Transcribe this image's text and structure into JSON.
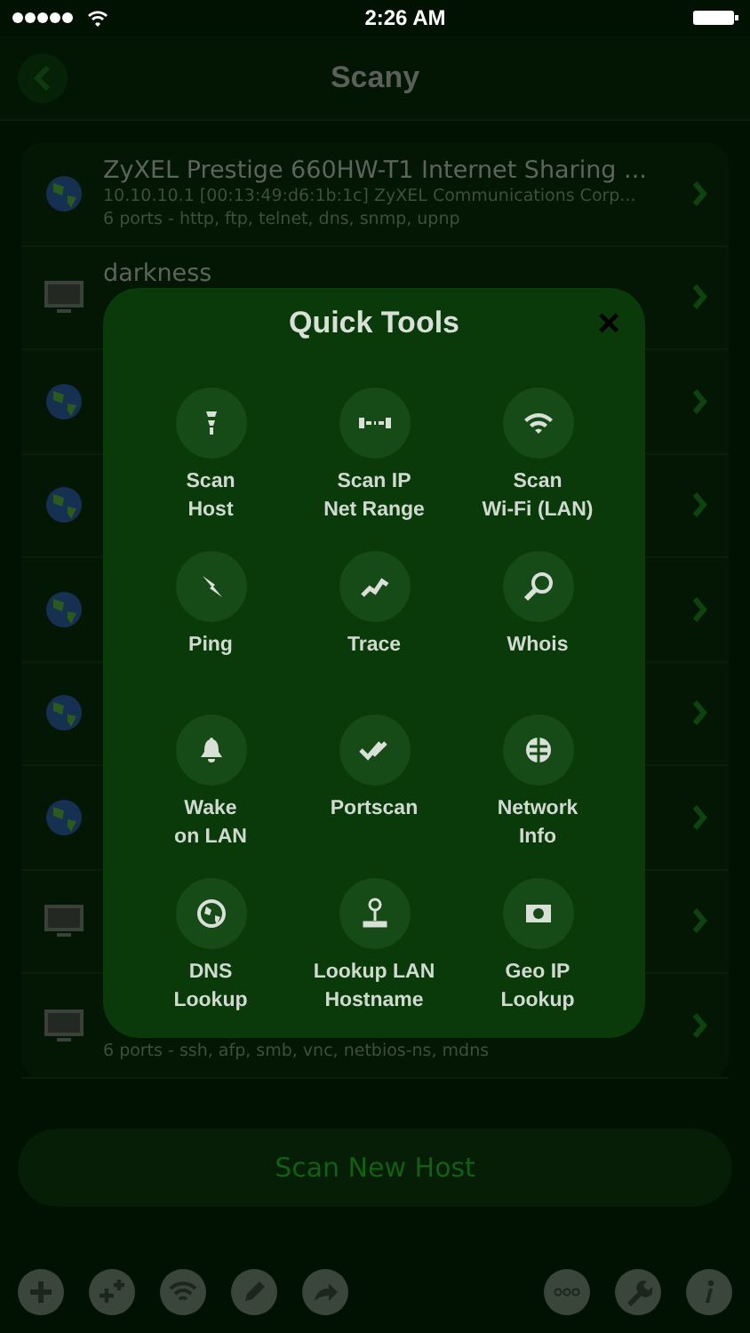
{
  "status_bar": {
    "time": "2:26 AM"
  },
  "nav": {
    "title": "Scany"
  },
  "hosts": [
    {
      "kind": "globe",
      "title": "ZyXEL Prestige 660HW-T1 Internet Sharing ...",
      "line1": "10.10.10.1 [00:13:49:d6:1b:1c] ZyXEL Communications Corp...",
      "line2": "6 ports - http, ftp, telnet, dns, snmp, upnp"
    },
    {
      "kind": "monitor",
      "title": "darkness"
    },
    {
      "kind": "globe"
    },
    {
      "kind": "globe"
    },
    {
      "kind": "globe"
    },
    {
      "kind": "globe"
    },
    {
      "kind": "globe"
    },
    {
      "kind": "monitor"
    },
    {
      "kind": "monitor",
      "line2": "6 ports - ssh, afp, smb, vnc, netbios-ns, mdns"
    }
  ],
  "quick_tools": {
    "title": "Quick Tools",
    "close": "×",
    "tools": [
      {
        "label": "Scan\nHost"
      },
      {
        "label": "Scan IP\nNet Range"
      },
      {
        "label": "Scan\nWi-Fi (LAN)"
      },
      {
        "label": "Ping"
      },
      {
        "label": "Trace"
      },
      {
        "label": "Whois"
      },
      {
        "label": "Wake\non LAN"
      },
      {
        "label": "Portscan"
      },
      {
        "label": "Network\nInfo"
      },
      {
        "label": "DNS\nLookup"
      },
      {
        "label": "Lookup LAN\nHostname"
      },
      {
        "label": "Geo IP\nLookup"
      }
    ]
  },
  "scan_button": "Scan New Host"
}
